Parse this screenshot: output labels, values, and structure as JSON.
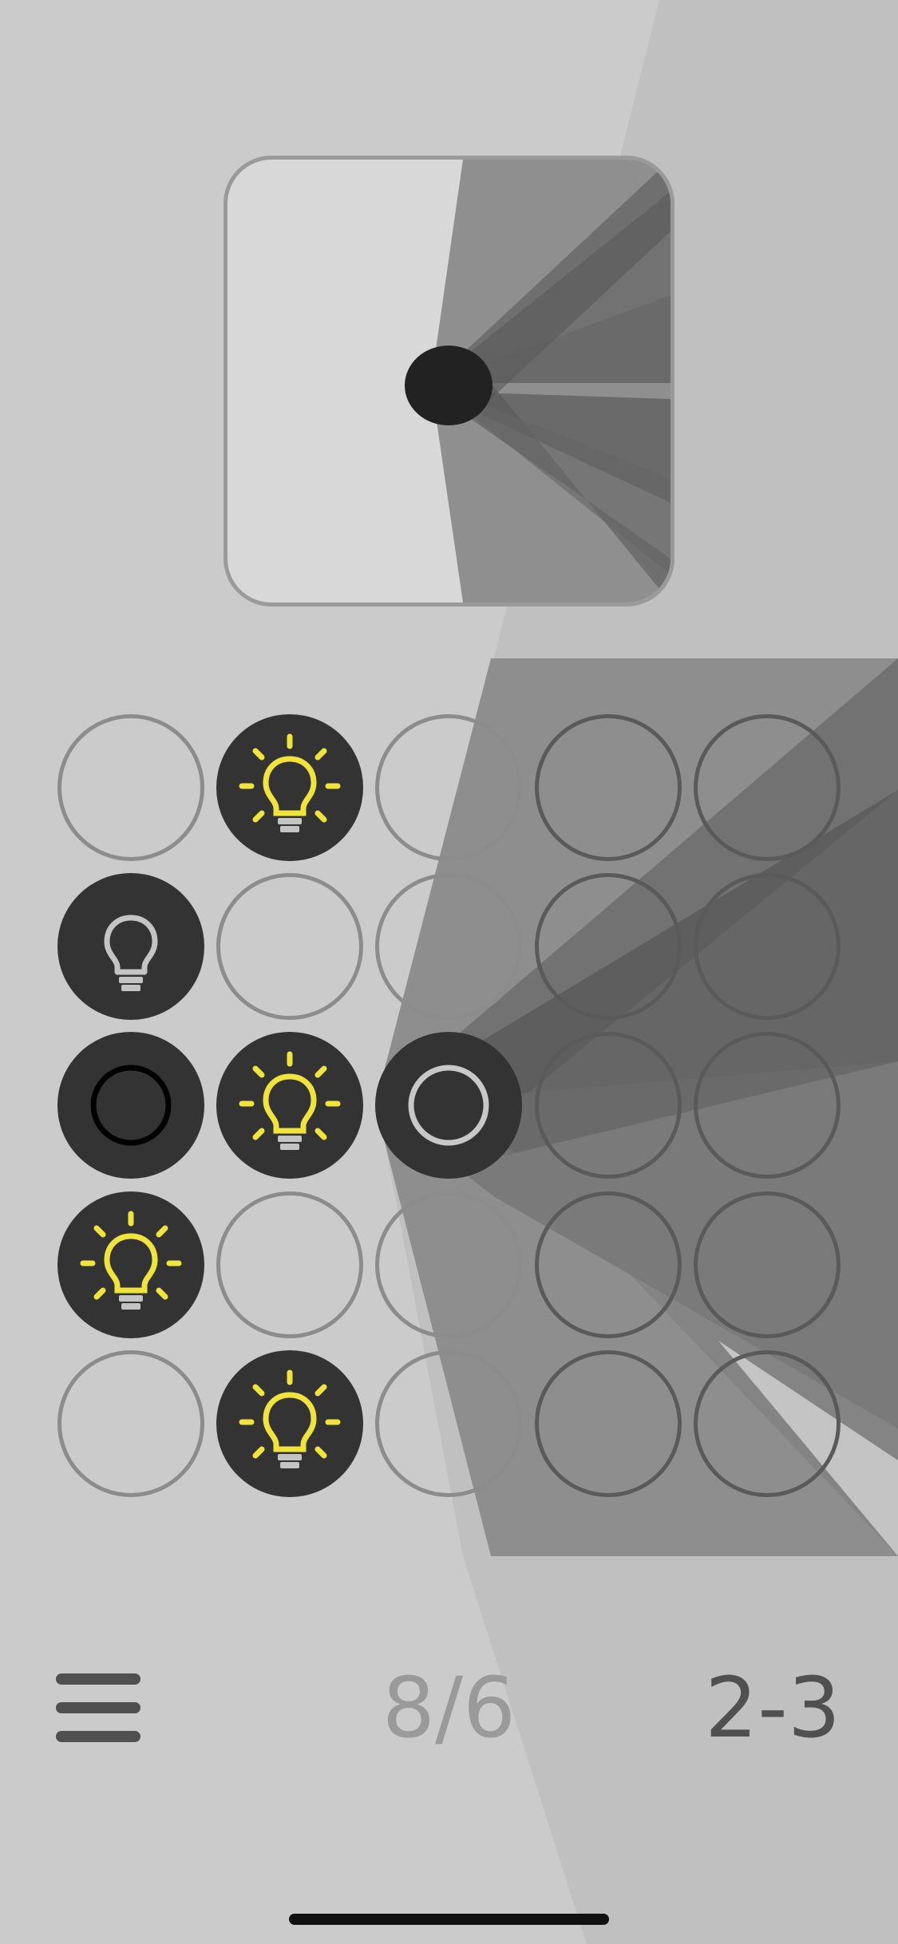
{
  "game": {
    "moves_display": "8/6",
    "level_label": "2-3"
  },
  "menu": {
    "icon": "hamburger-menu-icon"
  },
  "board": {
    "rows": 5,
    "cols": 5,
    "cells": [
      [
        "empty",
        "bulb-on",
        "empty",
        "empty",
        "empty"
      ],
      [
        "bulb-off",
        "empty",
        "empty",
        "empty",
        "empty"
      ],
      [
        "ring-dark",
        "bulb-on",
        "ring-light",
        "empty",
        "empty"
      ],
      [
        "bulb-on",
        "empty",
        "empty",
        "empty",
        "empty"
      ],
      [
        "empty",
        "bulb-on",
        "empty",
        "empty",
        "empty"
      ]
    ]
  },
  "colors": {
    "background": "#cbcbcb",
    "tile_dark": "#333333",
    "bulb_on": "#f0e43c",
    "bulb_off": "#c4c4c4",
    "text_muted": "#9a9a9a",
    "text_dark": "#505050"
  }
}
